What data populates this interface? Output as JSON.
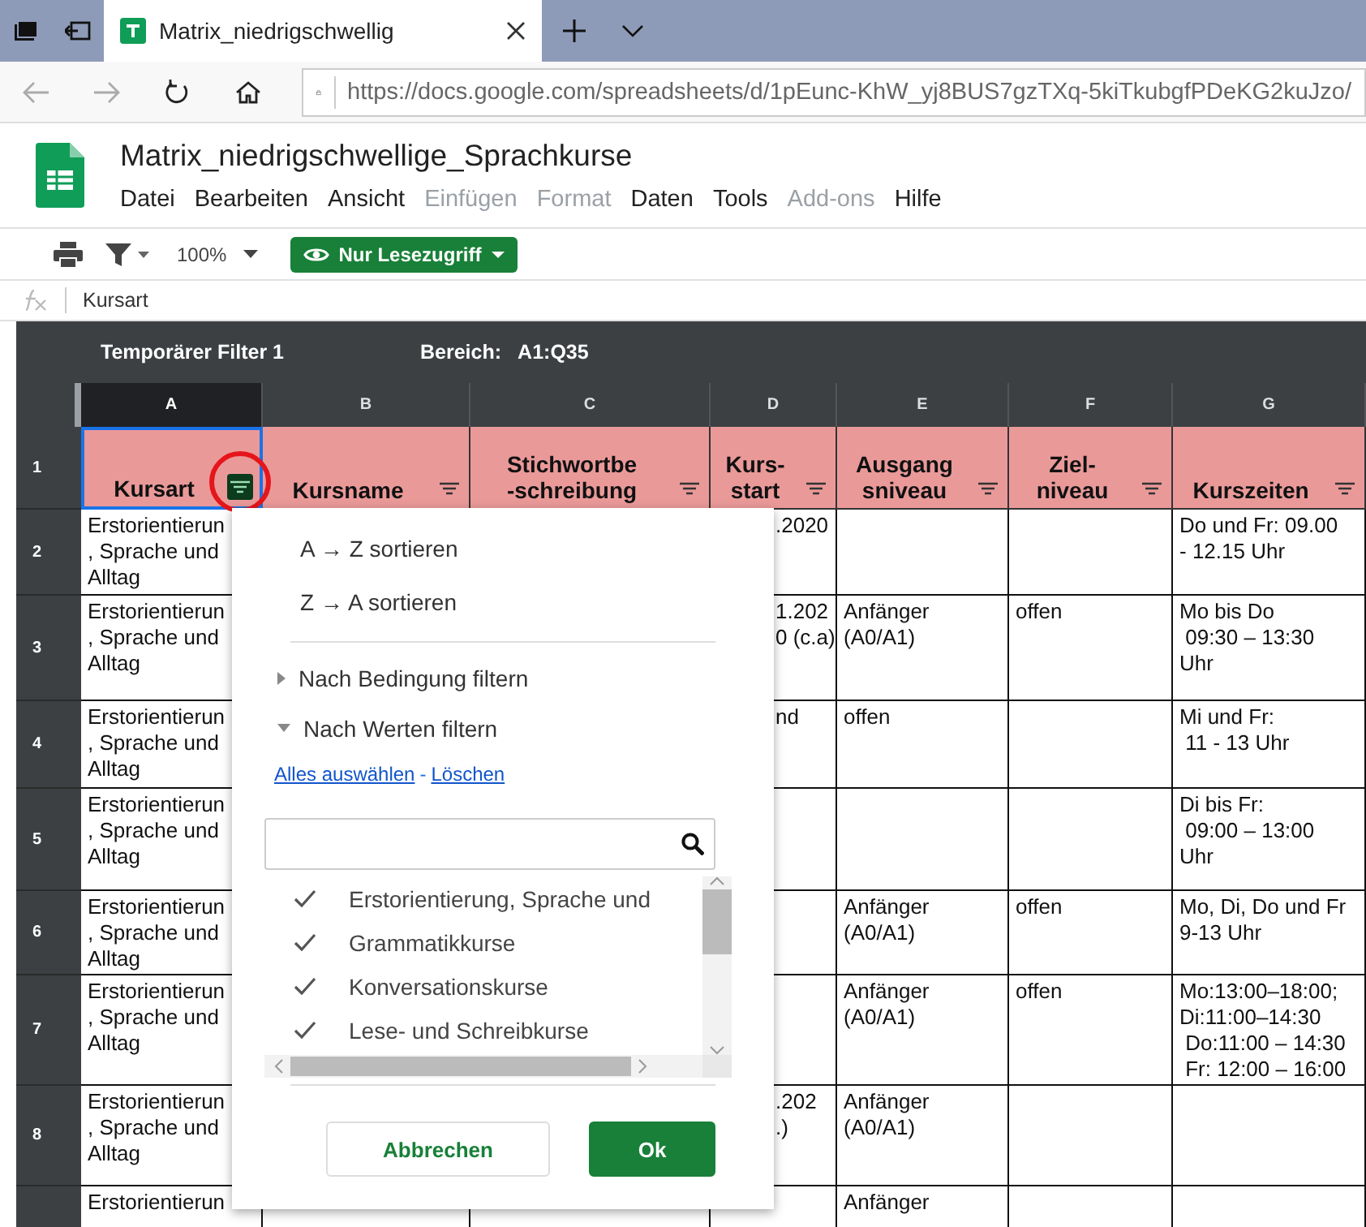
{
  "browser": {
    "tab": {
      "title": "Matrix_niedrigschwellig",
      "selected": true
    },
    "url": "https://docs.google.com/spreadsheets/d/1pEunc-KhW_yj8BUS7gzTXq-5kiTkubgfPDeKG2kuJzo/"
  },
  "document": {
    "title": "Matrix_niedrigschwellige_Sprachkurse",
    "menu": [
      {
        "label": "Datei",
        "disabled": false
      },
      {
        "label": "Bearbeiten",
        "disabled": false
      },
      {
        "label": "Ansicht",
        "disabled": false
      },
      {
        "label": "Einfügen",
        "disabled": true
      },
      {
        "label": "Format",
        "disabled": true
      },
      {
        "label": "Daten",
        "disabled": false
      },
      {
        "label": "Tools",
        "disabled": false
      },
      {
        "label": "Add-ons",
        "disabled": true
      },
      {
        "label": "Hilfe",
        "disabled": false
      }
    ]
  },
  "toolbar": {
    "zoom": "100%",
    "view_mode": "Nur Lesezugriff"
  },
  "formula_bar": {
    "value": "Kursart"
  },
  "filter_bar": {
    "name": "Temporärer Filter 1",
    "range_label": "Bereich:",
    "range": "A1:Q35"
  },
  "sheet": {
    "columns": [
      {
        "letter": "A",
        "header": "Kursart",
        "selected": true
      },
      {
        "letter": "B",
        "header": "Kursname",
        "selected": false
      },
      {
        "letter": "C",
        "header": "Stichwortbe\n-schreibung",
        "selected": false
      },
      {
        "letter": "D",
        "header": "Kurs-\nstart",
        "selected": false
      },
      {
        "letter": "E",
        "header": "Ausgang\nsniveau",
        "selected": false
      },
      {
        "letter": "F",
        "header": "Ziel-\nniveau",
        "selected": false
      },
      {
        "letter": "G",
        "header": "Kurszeiten",
        "selected": false
      }
    ],
    "header_row": "1",
    "rows": [
      {
        "number": "2",
        "kursart": "Erstorientierun\n, Sprache und\nAlltag",
        "kurs_start": ".2020",
        "kurszeiten": "Do und Fr: 09.00\n- 12.15 Uhr"
      },
      {
        "number": "3",
        "kursart": "Erstorientierun\n, Sprache und\nAlltag",
        "kurs_start": "1.202\n0 (c.a)",
        "ausgangsniveau": "Anfänger\n(A0/A1)",
        "zielniveau": "offen",
        "kurszeiten": "Mo bis Do\n 09:30 – 13:30\nUhr"
      },
      {
        "number": "4",
        "kursart": "Erstorientierun\n, Sprache und\nAlltag",
        "kurs_start": "nd",
        "ausgangsniveau": "offen",
        "kurszeiten": "Mi und Fr:\n 11 - 13 Uhr"
      },
      {
        "number": "5",
        "kursart": "Erstorientierun\n, Sprache und\nAlltag",
        "kurszeiten": "Di bis Fr:\n 09:00 – 13:00\nUhr"
      },
      {
        "number": "6",
        "kursart": "Erstorientierun\n, Sprache und\nAlltag",
        "ausgangsniveau": "Anfänger\n(A0/A1)",
        "zielniveau": "offen",
        "kurszeiten": "Mo, Di, Do und Fr\n9-13 Uhr"
      },
      {
        "number": "7",
        "kursart": "Erstorientierun\n, Sprache und\nAlltag",
        "ausgangsniveau": "Anfänger\n(A0/A1)",
        "zielniveau": "offen",
        "kurszeiten": "Mo:13:00–18:00;\nDi:11:00–14:30\n Do:11:00 – 14:30\n Fr: 12:00 – 16:00"
      },
      {
        "number": "8",
        "kursart": "Erstorientierun\n, Sprache und\nAlltag",
        "kurs_start": ".202\n.)",
        "ausgangsniveau": "Anfänger\n(A0/A1)"
      },
      {
        "kursart": "Erstorientierun",
        "ausgangsniveau": "Anfänger"
      }
    ]
  },
  "filter_menu": {
    "sort": [
      "A → Z sortieren",
      "Z → A sortieren"
    ],
    "sections": [
      {
        "label": "Nach Bedingung filtern",
        "expanded": false
      },
      {
        "label": "Nach Werten filtern",
        "expanded": true
      }
    ],
    "select_all": "Alles auswählen",
    "separator": "-",
    "clear": "Löschen",
    "values": [
      {
        "label": "Erstorientierung, Sprache und",
        "checked": true
      },
      {
        "label": "Grammatikkurse",
        "checked": true
      },
      {
        "label": "Konversationskurse",
        "checked": true
      },
      {
        "label": "Lese- und Schreibkurse",
        "checked": true
      }
    ],
    "buttons": [
      {
        "label": "Abbrechen",
        "kind": "secondary"
      },
      {
        "label": "Ok",
        "kind": "primary"
      }
    ]
  }
}
